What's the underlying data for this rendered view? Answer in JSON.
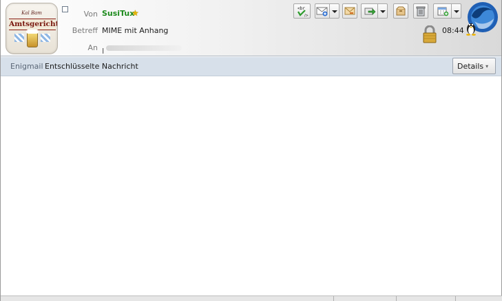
{
  "header": {
    "logo": {
      "top_text": "Kal  Bam",
      "main_text": "Amtsgericht"
    },
    "from": {
      "label": "Von",
      "value": "SusiTux"
    },
    "subject": {
      "label": "Betreff",
      "value": "MIME mit Anhang"
    },
    "to": {
      "label": "An",
      "value": "I"
    },
    "time": "08:44"
  },
  "toolbar": {
    "buttons": [
      {
        "name": "html-view-button",
        "icon": "br-tag-icon"
      },
      {
        "name": "new-message-button",
        "icon": "envelope-plus-icon"
      },
      {
        "name": "forward-button",
        "icon": "envelope-arrow-icon"
      },
      {
        "name": "export-button",
        "icon": "green-arrow-icon"
      },
      {
        "name": "archive-button",
        "icon": "box-icon"
      },
      {
        "name": "delete-button",
        "icon": "trash-icon"
      },
      {
        "name": "add-event-button",
        "icon": "calendar-plus-icon"
      }
    ]
  },
  "enigmail": {
    "label": "Enigmail",
    "message": "Entschlüsselte Nachricht",
    "details_label": "Details"
  },
  "colors": {
    "sender": "#1c8a1c",
    "enigmail_bar": "#d7e0ea"
  }
}
